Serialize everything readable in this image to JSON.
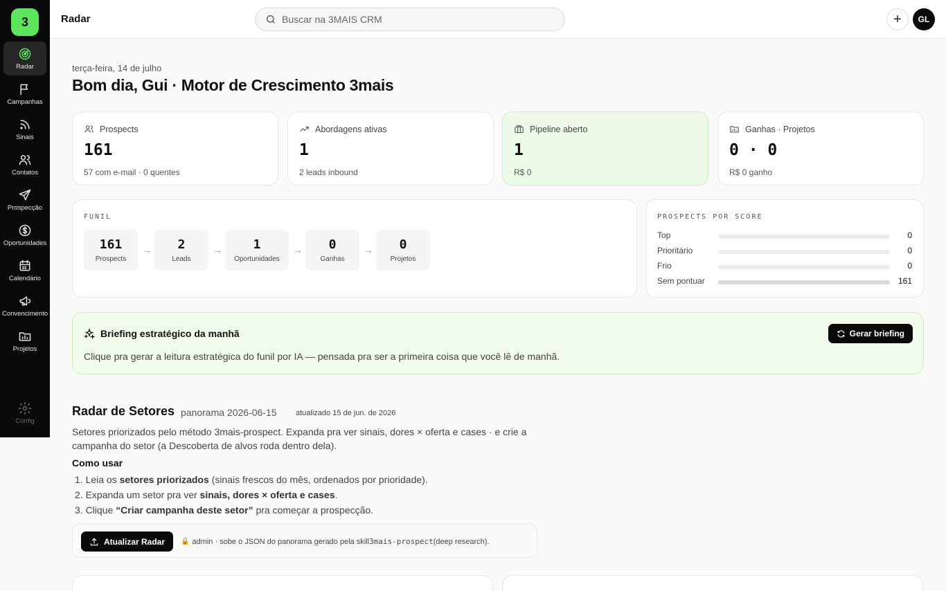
{
  "app": {
    "logo": "3",
    "page_title": "Radar"
  },
  "sidebar": {
    "items": [
      {
        "label": "Radar",
        "icon": "radar-icon",
        "active": true
      },
      {
        "label": "Campanhas",
        "icon": "flag-icon"
      },
      {
        "label": "Sinais",
        "icon": "rss-icon"
      },
      {
        "label": "Contatos",
        "icon": "users-icon"
      },
      {
        "label": "Prospecção",
        "icon": "send-icon"
      },
      {
        "label": "Oportunidades",
        "icon": "dollar-circle-icon"
      },
      {
        "label": "Calendário",
        "icon": "calendar-icon"
      },
      {
        "label": "Convencimento",
        "icon": "megaphone-icon"
      },
      {
        "label": "Projetos",
        "icon": "folder-chart-icon"
      }
    ],
    "config": {
      "label": "Config",
      "icon": "gear-icon"
    }
  },
  "topbar": {
    "search_placeholder": "Buscar na 3MAIS CRM",
    "add_label": "+",
    "avatar_initials": "GL"
  },
  "header": {
    "date": "terça-feira, 14 de julho",
    "greeting": "Bom dia, Gui · Motor de Crescimento 3mais"
  },
  "stats": [
    {
      "label": "Prospects",
      "value": "161",
      "sub": "57 com e-mail · 0 quentes",
      "icon": "users-icon"
    },
    {
      "label": "Abordagens ativas",
      "value": "1",
      "sub": "2 leads inbound",
      "icon": "trending-up-icon"
    },
    {
      "label": "Pipeline aberto",
      "value": "1",
      "sub": "R$ 0",
      "icon": "briefcase-icon"
    },
    {
      "label": "Ganhas · Projetos",
      "value": "0 · 0",
      "sub": "R$ 0 ganho",
      "icon": "folder-icon"
    }
  ],
  "funnel": {
    "label": "FUNIL",
    "steps": [
      {
        "value": "161",
        "label": "Prospects"
      },
      {
        "value": "2",
        "label": "Leads"
      },
      {
        "value": "1",
        "label": "Oportunidades"
      },
      {
        "value": "0",
        "label": "Ganhas"
      },
      {
        "value": "0",
        "label": "Projetos"
      }
    ]
  },
  "score": {
    "label": "PROSPECTS POR SCORE",
    "rows": [
      {
        "label": "Top",
        "value": "0",
        "fraction": 0
      },
      {
        "label": "Prioritário",
        "value": "0",
        "fraction": 0
      },
      {
        "label": "Frio",
        "value": "0",
        "fraction": 0
      },
      {
        "label": "Sem pontuar",
        "value": "161",
        "fraction": 1
      }
    ]
  },
  "briefing": {
    "title": "Briefing estratégico da manhã",
    "button": "Gerar briefing",
    "body": "Clique pra gerar a leitura estratégica do funil por IA — pensada pra ser a primeira coisa que você lê de manhã."
  },
  "radar": {
    "title": "Radar de Setores",
    "panorama": "panorama 2026-06-15",
    "updated": "atualizado 15 de jun. de 2026",
    "description": "Setores priorizados pelo método 3mais-prospect. Expanda pra ver sinais, dores × oferta e cases · e crie a campanha do setor (a Descoberta de alvos roda dentro dela).",
    "howto_title": "Como usar",
    "steps": [
      {
        "pre": "1. Leia os ",
        "bold": "setores priorizados",
        "post": " (sinais frescos do mês, ordenados por prioridade)."
      },
      {
        "pre": "2. Expanda um setor pra ver ",
        "bold": "sinais, dores × oferta e cases",
        "post": "."
      },
      {
        "pre": "3. Clique ",
        "bold": "“Criar campanha deste setor”",
        "post": " pra começar a prospecção."
      }
    ],
    "update_button": "Atualizar Radar",
    "update_note_pre": "admin · sobe o JSON do panorama gerado pela skill ",
    "update_note_code": "3mais-prospect",
    "update_note_post": " (deep research)."
  }
}
